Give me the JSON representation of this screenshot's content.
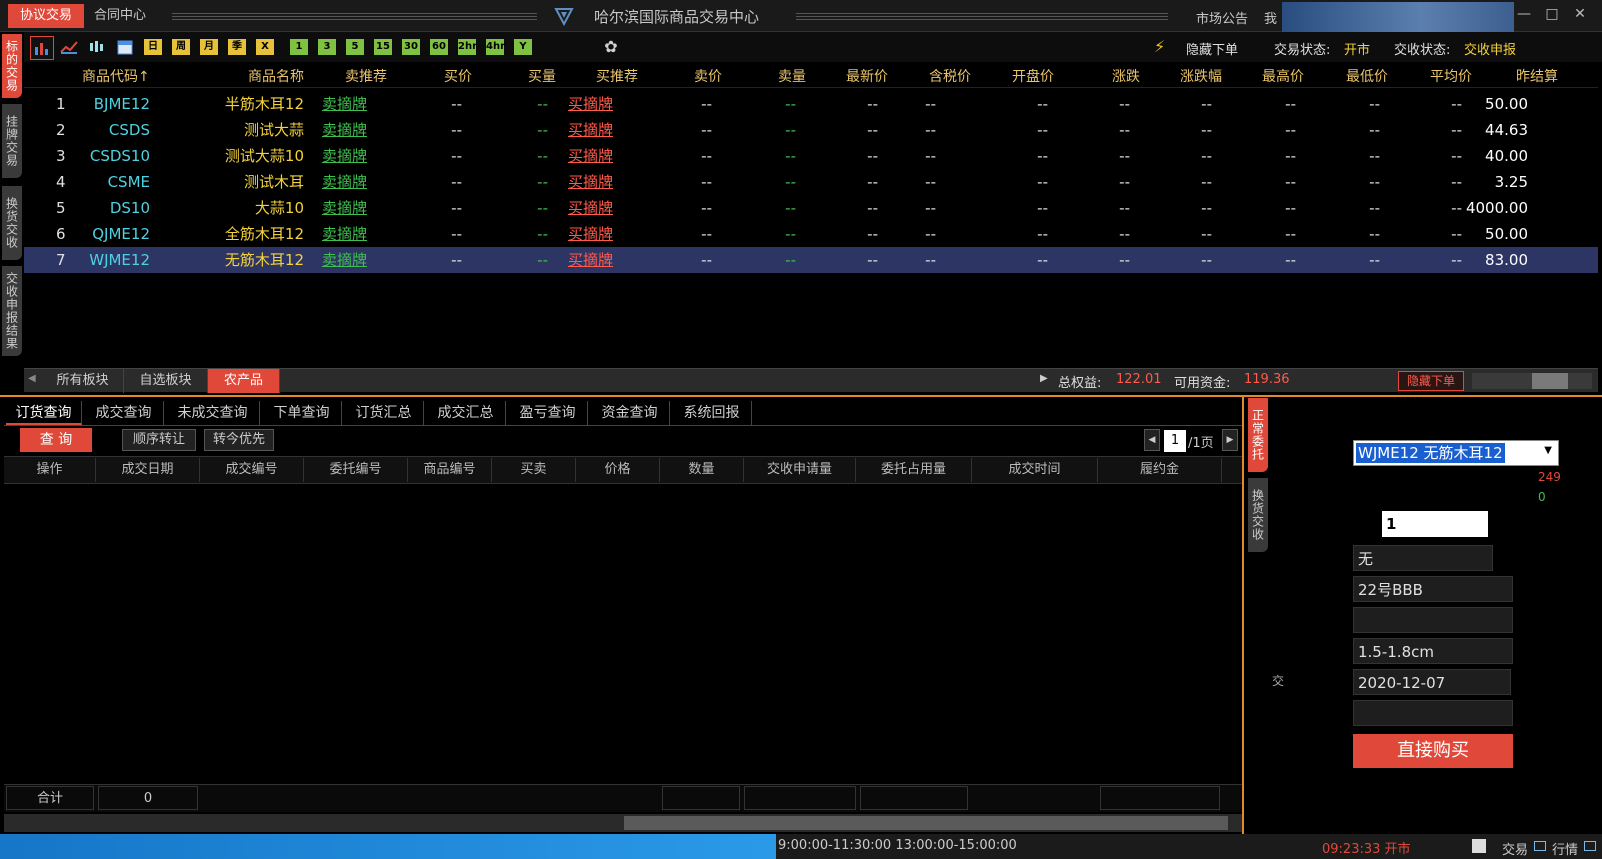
{
  "titlebar": {
    "tabs": [
      "协议交易",
      "合同中心"
    ],
    "app_title": "哈尔滨国际商品交易中心",
    "right_links": [
      "市场公告",
      "我"
    ],
    "win_controls": [
      "—",
      "□",
      "✕"
    ]
  },
  "toolbar": {
    "period_buttons": [
      "日",
      "周",
      "月",
      "季",
      "X"
    ],
    "minute_buttons": [
      "1",
      "3",
      "5",
      "15",
      "30",
      "60",
      "2hr",
      "4hr",
      "Y"
    ],
    "hide_order_label": "隐藏下单",
    "trade_status_label": "交易状态:",
    "trade_status_value": "开市",
    "delivery_status_label": "交收状态:",
    "delivery_status_value": "交收申报"
  },
  "left_tabs": [
    "标的交易",
    "挂牌交易",
    "换货交收",
    "交收申报结果"
  ],
  "market": {
    "headers": [
      "商品代码↑",
      "商品名称",
      "卖推荐",
      "买价",
      "买量",
      "买推荐",
      "卖价",
      "卖量",
      "最新价",
      "含税价",
      "开盘价",
      "涨跌",
      "涨跌幅",
      "最高价",
      "最低价",
      "平均价",
      "昨结算"
    ],
    "rows": [
      {
        "idx": "1",
        "code": "BJME12",
        "name": "半筋木耳12",
        "sell": "卖摘牌",
        "buy": "买摘牌",
        "settle": "50.00"
      },
      {
        "idx": "2",
        "code": "CSDS",
        "name": "测试大蒜",
        "sell": "卖摘牌",
        "buy": "买摘牌",
        "settle": "44.63"
      },
      {
        "idx": "3",
        "code": "CSDS10",
        "name": "测试大蒜10",
        "sell": "卖摘牌",
        "buy": "买摘牌",
        "settle": "40.00"
      },
      {
        "idx": "4",
        "code": "CSME",
        "name": "测试木耳",
        "sell": "卖摘牌",
        "buy": "买摘牌",
        "settle": "3.25"
      },
      {
        "idx": "5",
        "code": "DS10",
        "name": "大蒜10",
        "sell": "卖摘牌",
        "buy": "买摘牌",
        "settle": "4000.00"
      },
      {
        "idx": "6",
        "code": "QJME12",
        "name": "全筋木耳12",
        "sell": "卖摘牌",
        "buy": "买摘牌",
        "settle": "50.00"
      },
      {
        "idx": "7",
        "code": "WJME12",
        "name": "无筋木耳12",
        "sell": "卖摘牌",
        "buy": "买摘牌",
        "settle": "83.00"
      }
    ],
    "dash": "--"
  },
  "boards": {
    "tabs": [
      "所有板块",
      "自选板块",
      "农产品"
    ],
    "equity_label": "总权益:",
    "equity_value": "122.01",
    "available_label": "可用资金:",
    "available_value": "119.36",
    "hide_order_btn": "隐藏下单"
  },
  "query": {
    "tabs": [
      "订货查询",
      "成交查询",
      "未成交查询",
      "下单查询",
      "订货汇总",
      "成交汇总",
      "盈亏查询",
      "资金查询",
      "系统回报"
    ],
    "query_btn": "查 询",
    "seq_btn": "顺序转让",
    "today_btn": "转今优先",
    "page_value": "1",
    "page_total": "/1页",
    "headers": [
      "操作",
      "成交日期",
      "成交编号",
      "委托编号",
      "商品编号",
      "买卖",
      "价格",
      "数量",
      "交收申请量",
      "委托占用量",
      "成交时间",
      "履约金"
    ],
    "total_label": "合计",
    "total_value": "0"
  },
  "right_panel": {
    "vtabs": [
      "正常委托",
      "换货交收"
    ],
    "product_select": "WJME12 无筋木耳12",
    "red_num": "249",
    "green_num": "0",
    "qty": "1",
    "fields": [
      "无",
      "22号BBB",
      "",
      "1.5-1.8cm",
      "2020-12-07",
      ""
    ],
    "side_char": "交",
    "buy_button": "直接购买"
  },
  "statusbar": {
    "time_ranges": "9:00:00-11:30:00  13:00:00-15:00:00",
    "clock": "09:23:33 开市",
    "trade_label": "交易",
    "quote_label": "行情"
  }
}
